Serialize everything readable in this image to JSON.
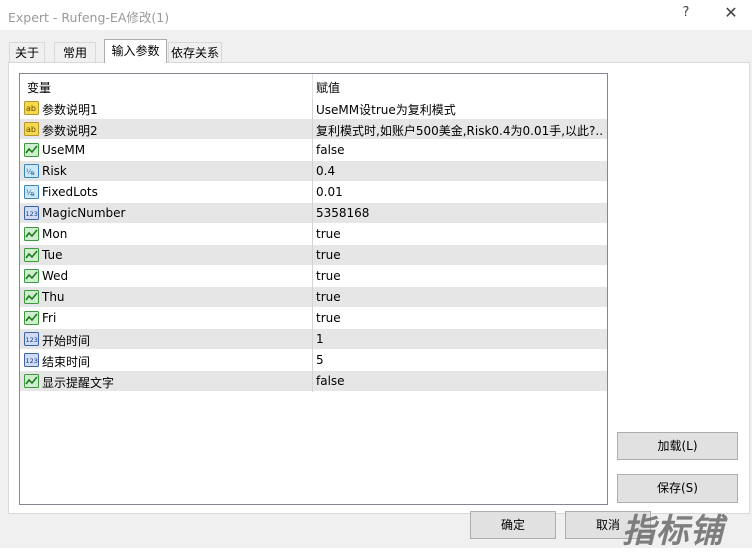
{
  "window": {
    "title": "Expert - Rufeng-EA修改(1)",
    "help_glyph": "?",
    "close_glyph": "✕"
  },
  "tabs": [
    {
      "label": "关于"
    },
    {
      "label": "常用"
    },
    {
      "label": "输入参数",
      "active": true
    },
    {
      "label": "依存关系"
    }
  ],
  "grid": {
    "col_variable": "变量",
    "col_value": "赋值",
    "rows": [
      {
        "name": "参数说明1",
        "value": "UseMM设true为复利模式",
        "icon": "string-ab-icon"
      },
      {
        "name": "参数说明2",
        "value": "复利模式时,如账户500美金,Risk0.4为0.01手,以此?..",
        "icon": "string-ab-icon"
      },
      {
        "name": "UseMM",
        "value": "false",
        "icon": "bool-icon"
      },
      {
        "name": "Risk",
        "value": "0.4",
        "icon": "double-icon"
      },
      {
        "name": "FixedLots",
        "value": "0.01",
        "icon": "double-icon"
      },
      {
        "name": "MagicNumber",
        "value": "5358168",
        "icon": "int-123-icon"
      },
      {
        "name": "Mon",
        "value": "true",
        "icon": "bool-icon"
      },
      {
        "name": "Tue",
        "value": "true",
        "icon": "bool-icon"
      },
      {
        "name": "Wed",
        "value": "true",
        "icon": "bool-icon"
      },
      {
        "name": "Thu",
        "value": "true",
        "icon": "bool-icon"
      },
      {
        "name": "Fri",
        "value": "true",
        "icon": "bool-icon"
      },
      {
        "name": "开始时间",
        "value": "1",
        "icon": "int-123-icon"
      },
      {
        "name": "结束时间",
        "value": "5",
        "icon": "int-123-icon"
      },
      {
        "name": "显示提醒文字",
        "value": "false",
        "icon": "bool-icon"
      }
    ]
  },
  "buttons": {
    "load": "加载(L)",
    "save": "保存(S)",
    "ok": "确定",
    "cancel": "取消"
  },
  "watermark": "指标铺"
}
